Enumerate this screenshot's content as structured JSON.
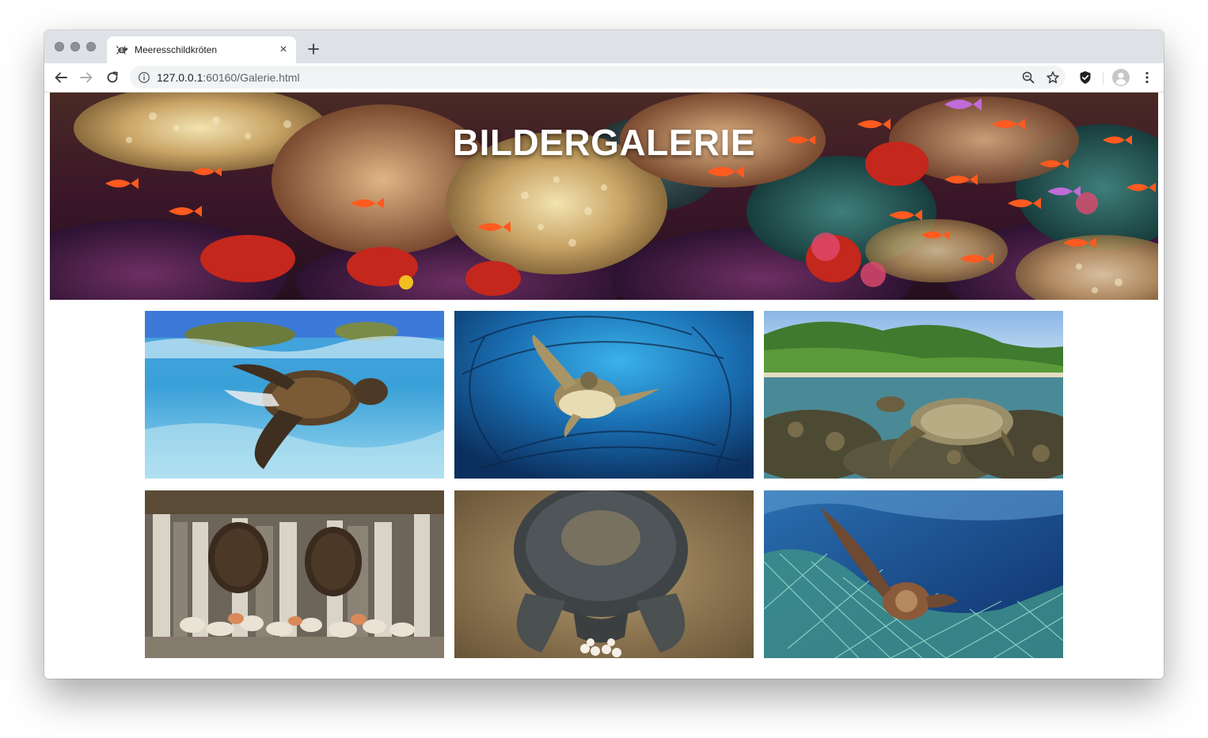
{
  "browser": {
    "tab_title": "Meeresschildkröten",
    "url_host": "127.0.0.1",
    "url_rest": ":60160/Galerie.html",
    "new_tab_label": "+",
    "close_label": "×"
  },
  "page": {
    "heading": "BILDERGALERIE"
  },
  "gallery": {
    "images": [
      {
        "subject": "turtle-swimming-at-surface"
      },
      {
        "subject": "turtle-with-fish-school"
      },
      {
        "subject": "turtle-over-reef-near-island"
      },
      {
        "subject": "turtle-shells-and-seashells-stall"
      },
      {
        "subject": "turtle-laying-eggs-in-sand"
      },
      {
        "subject": "turtle-entangled-in-fishing-net"
      }
    ]
  },
  "colors": {
    "tabstrip": "#dee1e6",
    "omnibox": "#f1f3f4",
    "heading_text": "#ffffff"
  }
}
